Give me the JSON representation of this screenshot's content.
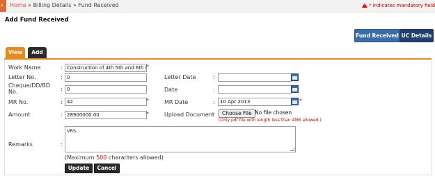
{
  "breadcrumb": {
    "home": "Home",
    "sep1": " » ",
    "billing": "Billing Details",
    "sep2": " » ",
    "current": "Fund Received"
  },
  "mandatory_note": "* indicates mandatory field",
  "page_title": "Add Fund Received",
  "header_buttons": {
    "fund_received": "Fund Received",
    "uc_details": "UC Details"
  },
  "tabs": {
    "view": "View",
    "add": "Add"
  },
  "form": {
    "work_name": {
      "label": "Work Name",
      "value": "Construction of 4th 5th and 6th Flo"
    },
    "letter_no": {
      "label": "Letter No.",
      "value": "0"
    },
    "letter_date": {
      "label": "Letter Date",
      "value": ""
    },
    "cheque_no": {
      "label_line1": "Cheque/DD/BD",
      "label_line2": "No.",
      "value": "0"
    },
    "date": {
      "label": "Date",
      "value": ""
    },
    "mr_no": {
      "label": "MR No.",
      "value": "42"
    },
    "mr_date": {
      "label": "MR Date",
      "value": "10 Apr 2013"
    },
    "amount": {
      "label": "Amount",
      "value": "28900000.00"
    },
    "upload": {
      "label": "Upload Document",
      "button": "Choose File",
      "status": "No file chosen",
      "note": "(Only pdf file with length less than 4MB allowed.)"
    },
    "remarks": {
      "label": "Remarks",
      "value": "VRS",
      "max_prefix": "(Maximum ",
      "max_count": "500",
      "max_suffix": " characters allowed)"
    }
  },
  "colon": ":",
  "required_mark": "*",
  "actions": {
    "update": "Update",
    "cancel": "Cancel"
  }
}
